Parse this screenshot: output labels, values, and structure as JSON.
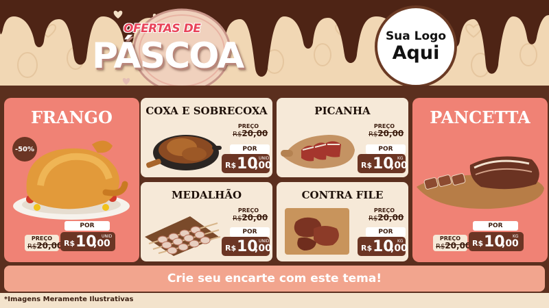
{
  "header": {
    "title_small": "OFERTAS DE",
    "title_main": "PÁSCOA"
  },
  "logo": {
    "line1": "Sua Logo",
    "line2": "Aqui"
  },
  "old_price_label": "PREÇO",
  "por_label": "POR",
  "products": {
    "frango": {
      "name": "FRANGO",
      "discount": "-50%",
      "old_currency": "R$",
      "old_price": "20,00",
      "currency": "R$",
      "price_int": "10",
      "price_cents": ",00",
      "unit": "UNID"
    },
    "coxa": {
      "name": "COXA E SOBRECOXA",
      "old_currency": "R$",
      "old_price": "20,00",
      "currency": "R$",
      "price_int": "10",
      "price_cents": ",00",
      "unit": "UNID"
    },
    "picanha": {
      "name": "PICANHA",
      "old_currency": "R$",
      "old_price": "20,00",
      "currency": "R$",
      "price_int": "10",
      "price_cents": ",00",
      "unit": "KG"
    },
    "medalhao": {
      "name": "MEDALHÃO",
      "old_currency": "R$",
      "old_price": "20,00",
      "currency": "R$",
      "price_int": "10",
      "price_cents": ",00",
      "unit": "UNID"
    },
    "contrafile": {
      "name": "CONTRA FILE",
      "old_currency": "R$",
      "old_price": "20,00",
      "currency": "R$",
      "price_int": "10",
      "price_cents": ",00",
      "unit": "KG"
    },
    "pancetta": {
      "name": "PANCETTA",
      "old_currency": "R$",
      "old_price": "20,00",
      "currency": "R$",
      "price_int": "10",
      "price_cents": ",00",
      "unit": "KG"
    }
  },
  "cta": "Crie seu encarte com este tema!",
  "footer_note": "*Imagens Meramente Ilustrativas",
  "colors": {
    "chocolate": "#5b2f1e",
    "pink": "#f08275",
    "cream": "#f6e9d8",
    "price_bg": "#6b3524"
  }
}
